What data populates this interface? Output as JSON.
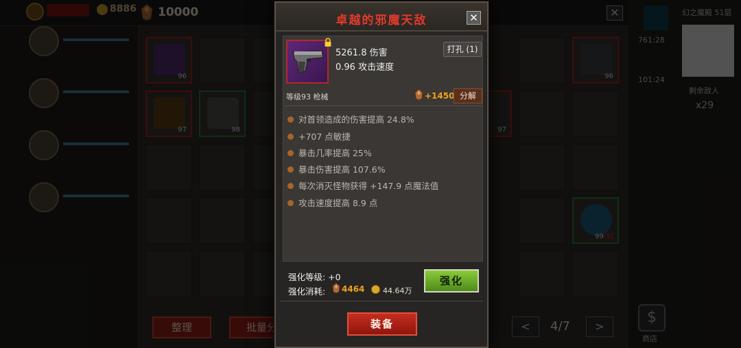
{
  "background": {
    "gold_count": "8886",
    "ore_count": "10000",
    "red_tag_label": "",
    "bottom_buttons": {
      "sort": "整理",
      "batch": "批量分解"
    },
    "pager": {
      "prev": "<",
      "next": ">",
      "page": "4/7"
    },
    "right_panel": {
      "mode_label": "幻之魔殿 51层",
      "time_1": "761:28",
      "time_2": "101:24",
      "remaining_label": "剩余敌人",
      "remaining_count": "x29",
      "shop_label": "商店",
      "shop_icon": "dollar-icon"
    },
    "grid_levels": [
      "96",
      "97",
      "98",
      "97",
      "96",
      "99",
      "(5)"
    ]
  },
  "modal": {
    "title": "卓越的邪魔天敌",
    "close_label": "✕",
    "item_icon": "pistol-icon",
    "damage_line": "5261.8 伤害",
    "speed_line": "0.96 攻击速度",
    "socket_button": "打孔 (1)",
    "level_line": "等级93  枪械",
    "decompose_reward": "+1450",
    "decompose_button": "分解",
    "attributes": [
      "对首领造成的伤害提高 24.8%",
      "+707 点敏捷",
      "暴击几率提高 25%",
      "暴击伤害提高 107.6%",
      "每次消灭怪物获得 +147.9 点魔法值",
      "攻击速度提高 8.9 点"
    ],
    "enhance_level_label": "强化等级: +0",
    "enhance_cost_label": "强化消耗:",
    "enhance_ore_cost": "4464",
    "enhance_gold_cost": "44.64万",
    "enhance_button": "强化",
    "equip_button": "装备"
  },
  "colors": {
    "title_red": "#e03a2c",
    "reward_orange": "#f0a020",
    "enhance_green": "#6fae2c",
    "equip_red": "#b8241a",
    "bullet_brown": "#a7652a"
  }
}
